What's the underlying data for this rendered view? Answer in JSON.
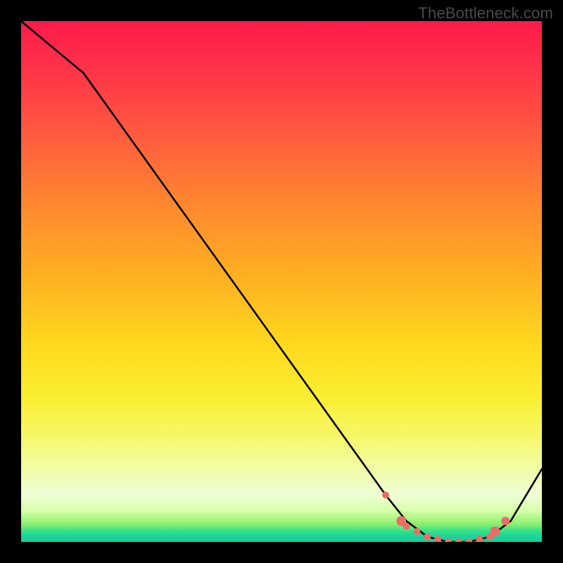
{
  "watermark": "TheBottleneck.com",
  "chart_data": {
    "type": "line",
    "title": "",
    "xlabel": "",
    "ylabel": "",
    "xlim": [
      0,
      100
    ],
    "ylim": [
      0,
      100
    ],
    "series": [
      {
        "name": "curve",
        "x": [
          0,
          6,
          12,
          70,
          74,
          78,
          82,
          86,
          90,
          94,
          100
        ],
        "y": [
          100,
          95,
          90,
          9,
          4,
          1,
          0,
          0,
          1,
          4,
          14
        ]
      }
    ],
    "markers": {
      "name": "trough-points",
      "color": "#eb6d66",
      "points": [
        {
          "x": 70,
          "y": 9,
          "r": 5
        },
        {
          "x": 73,
          "y": 4,
          "r": 7
        },
        {
          "x": 74,
          "y": 3,
          "r": 5
        },
        {
          "x": 76,
          "y": 2,
          "r": 5
        },
        {
          "x": 78,
          "y": 1,
          "r": 5
        },
        {
          "x": 80,
          "y": 0.5,
          "r": 5
        },
        {
          "x": 82,
          "y": 0,
          "r": 5
        },
        {
          "x": 84,
          "y": 0,
          "r": 5
        },
        {
          "x": 86,
          "y": 0,
          "r": 5
        },
        {
          "x": 88,
          "y": 0.5,
          "r": 5
        },
        {
          "x": 90,
          "y": 1,
          "r": 5
        },
        {
          "x": 91,
          "y": 2,
          "r": 7
        },
        {
          "x": 93,
          "y": 4,
          "r": 6
        }
      ]
    },
    "gradient": {
      "top": "#ff1a4b",
      "mid": "#ffd81e",
      "bottom": "#16cf9b"
    }
  }
}
